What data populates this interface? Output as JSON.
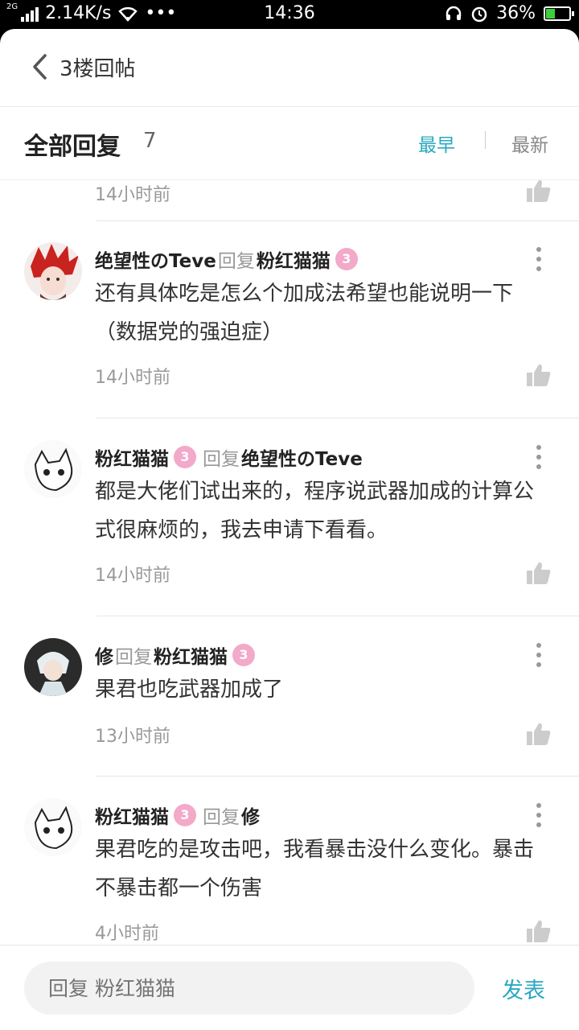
{
  "status_bar": {
    "net_type": "2G",
    "speed": "2.14K/s",
    "dots": "•••",
    "time": "14:36",
    "battery": "36%",
    "battery_level": 0.36
  },
  "topbar": {
    "title": "3楼回帖"
  },
  "section": {
    "title": "全部回复",
    "count": "7",
    "sort_early": "最早",
    "sort_new": "最新"
  },
  "previous_time": "14小时前",
  "replies": [
    {
      "author": "绝望性のTeve",
      "reply_word": "回复",
      "target": "粉红猫猫",
      "target_badge": "3",
      "text": "还有具体吃是怎么个加成法希望也能说明一下（数据党的强迫症）",
      "time": "14小时前"
    },
    {
      "author": "粉红猫猫",
      "author_badge": "3",
      "reply_word": "回复",
      "target": "绝望性のTeve",
      "text": "都是大佬们试出来的，程序说武器加成的计算公式很麻烦的，我去申请下看看。",
      "time": "14小时前"
    },
    {
      "author": "修",
      "reply_word": "回复",
      "target": "粉红猫猫",
      "target_badge": "3",
      "text": "果君也吃武器加成了",
      "time": "13小时前"
    },
    {
      "author": "粉红猫猫",
      "author_badge": "3",
      "reply_word": "回复",
      "target": "修",
      "text": "果君吃的是攻击吧，我看暴击没什么变化。暴击不暴击都一个伤害",
      "time": "4小时前"
    }
  ],
  "reply_bar": {
    "placeholder": "回复 粉红猫猫",
    "send": "发表"
  },
  "colors": {
    "accent": "#2aa9c0",
    "badge": "#f3a9c9"
  }
}
